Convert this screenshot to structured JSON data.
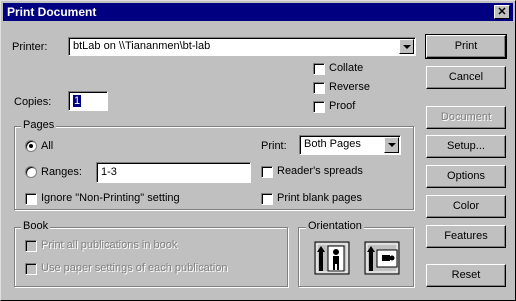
{
  "window": {
    "title": "Print Document",
    "close_glyph": "✕"
  },
  "printer": {
    "label": "Printer:",
    "value": "btLab on \\\\Tiananmen\\bt-lab"
  },
  "copies": {
    "label": "Copies:",
    "value": "1"
  },
  "options": {
    "collate": "Collate",
    "reverse": "Reverse",
    "proof": "Proof"
  },
  "pages": {
    "group_title": "Pages",
    "all_label": "All",
    "ranges_label": "Ranges:",
    "ranges_value": "1-3",
    "ignore_label": "Ignore \"Non-Printing\" setting",
    "print_label": "Print:",
    "print_value": "Both Pages",
    "readers_label": "Reader's spreads",
    "blank_label": "Print blank pages"
  },
  "book": {
    "group_title": "Book",
    "all_pubs": "Print all publications in book",
    "paper_settings": "Use paper settings of each publication"
  },
  "orientation": {
    "group_title": "Orientation",
    "portrait_icon": "portrait-icon",
    "landscape_icon": "landscape-icon"
  },
  "buttons": {
    "print": "Print",
    "cancel": "Cancel",
    "document": "Document",
    "setup": "Setup...",
    "options": "Options",
    "color": "Color",
    "features": "Features",
    "reset": "Reset"
  }
}
